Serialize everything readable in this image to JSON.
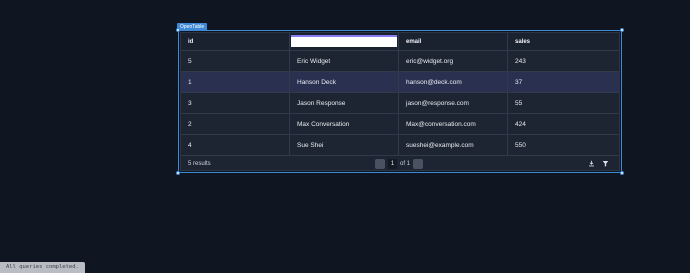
{
  "component": {
    "label": "OpenTable"
  },
  "table": {
    "columns": [
      "id",
      "",
      "email",
      "sales"
    ],
    "rows": [
      {
        "id": "5",
        "name": "Eric Widget",
        "email": "eric@widget.org",
        "sales": "243"
      },
      {
        "id": "1",
        "name": "Hanson Deck",
        "email": "hanson@deck.com",
        "sales": "37"
      },
      {
        "id": "3",
        "name": "Jason Response",
        "email": "jason@response.com",
        "sales": "55"
      },
      {
        "id": "2",
        "name": "Max Conversation",
        "email": "Max@conversation.com",
        "sales": "424"
      },
      {
        "id": "4",
        "name": "Sue Shei",
        "email": "sueshei@example.com",
        "sales": "550"
      }
    ],
    "header_input_value": ""
  },
  "footer": {
    "results_label": "5 results",
    "current_page": "1",
    "page_of": "of 1",
    "icons": [
      "download-icon",
      "filter-icon"
    ]
  },
  "status": {
    "text": "All queries completed."
  },
  "colors": {
    "background": "#101621",
    "table_bg": "#1d2532",
    "selected_row": "#2a3150",
    "accent": "#3e89d6",
    "header_input_border": "#8b7cf6"
  }
}
